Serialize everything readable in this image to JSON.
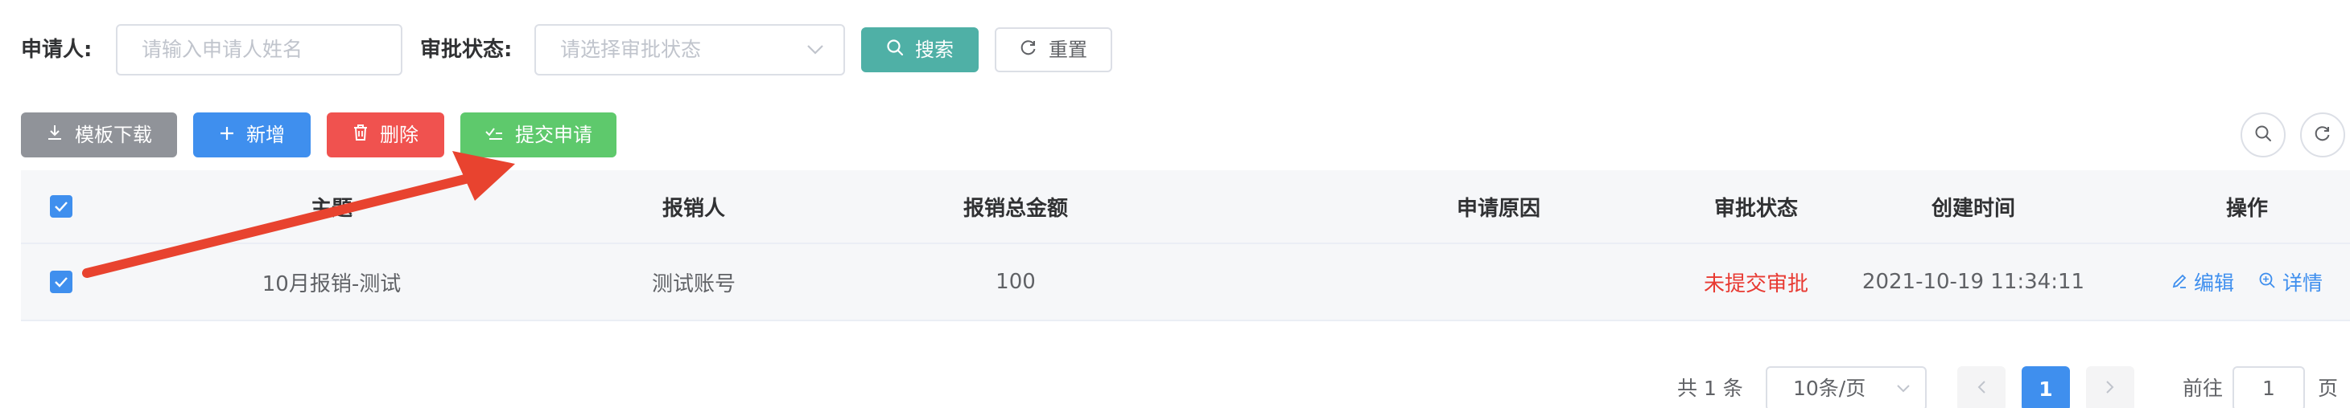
{
  "search": {
    "applicant_label": "申请人:",
    "applicant_placeholder": "请输入申请人姓名",
    "status_label": "审批状态:",
    "status_placeholder": "请选择审批状态",
    "search_button": "搜索",
    "reset_button": "重置"
  },
  "toolbar": {
    "template_download": "模板下载",
    "add": "新增",
    "delete": "删除",
    "submit": "提交申请"
  },
  "table": {
    "columns": [
      "主题",
      "报销人",
      "报销总金额",
      "申请原因",
      "审批状态",
      "创建时间",
      "操作"
    ],
    "rows": [
      {
        "checked": true,
        "subject": "10月报销-测试",
        "reimburser": "测试账号",
        "amount": "100",
        "reason": "",
        "status": "未提交审批",
        "created": "2021-10-19 11:34:11",
        "edit": "编辑",
        "detail": "详情"
      }
    ]
  },
  "pagination": {
    "total_text": "共 1 条",
    "page_size": "10条/页",
    "current_page": "1",
    "goto_label": "前往",
    "goto_value": "1",
    "page_suffix": "页"
  },
  "colors": {
    "primary": "#3f8fee",
    "search": "#4fb0a6",
    "danger": "#f0524f",
    "success": "#5ec96c",
    "info": "#909399",
    "status_red": "#e83a32",
    "annotation_arrow": "#e8432f"
  }
}
